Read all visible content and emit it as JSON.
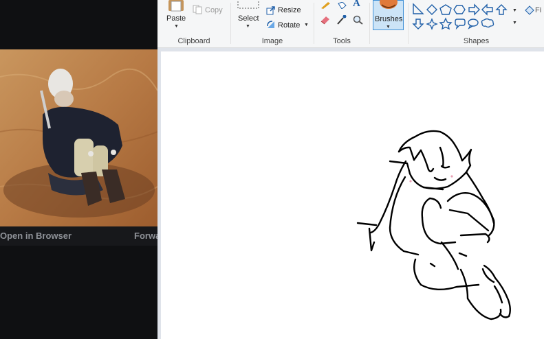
{
  "viewer": {
    "open_in_browser": "Open in Browser",
    "forward": "Forwa"
  },
  "ribbon": {
    "clipboard": {
      "paste": "Paste",
      "copy": "Copy",
      "label": "Clipboard"
    },
    "image": {
      "select": "Select",
      "resize": "Resize",
      "rotate": "Rotate",
      "label": "Image"
    },
    "tools": {
      "label": "Tools"
    },
    "brushes": {
      "label": "Brushes"
    },
    "shapes": {
      "label": "Shapes",
      "fill_partial": "Fi"
    }
  },
  "colors": {
    "ribbon_bg": "#f5f6f7",
    "selected_bg": "#cce4f7",
    "selected_border": "#3f90d6",
    "shape_blue": "#1f5fa8",
    "canvas": "#ffffff",
    "workspace": "#dfe3ea"
  }
}
